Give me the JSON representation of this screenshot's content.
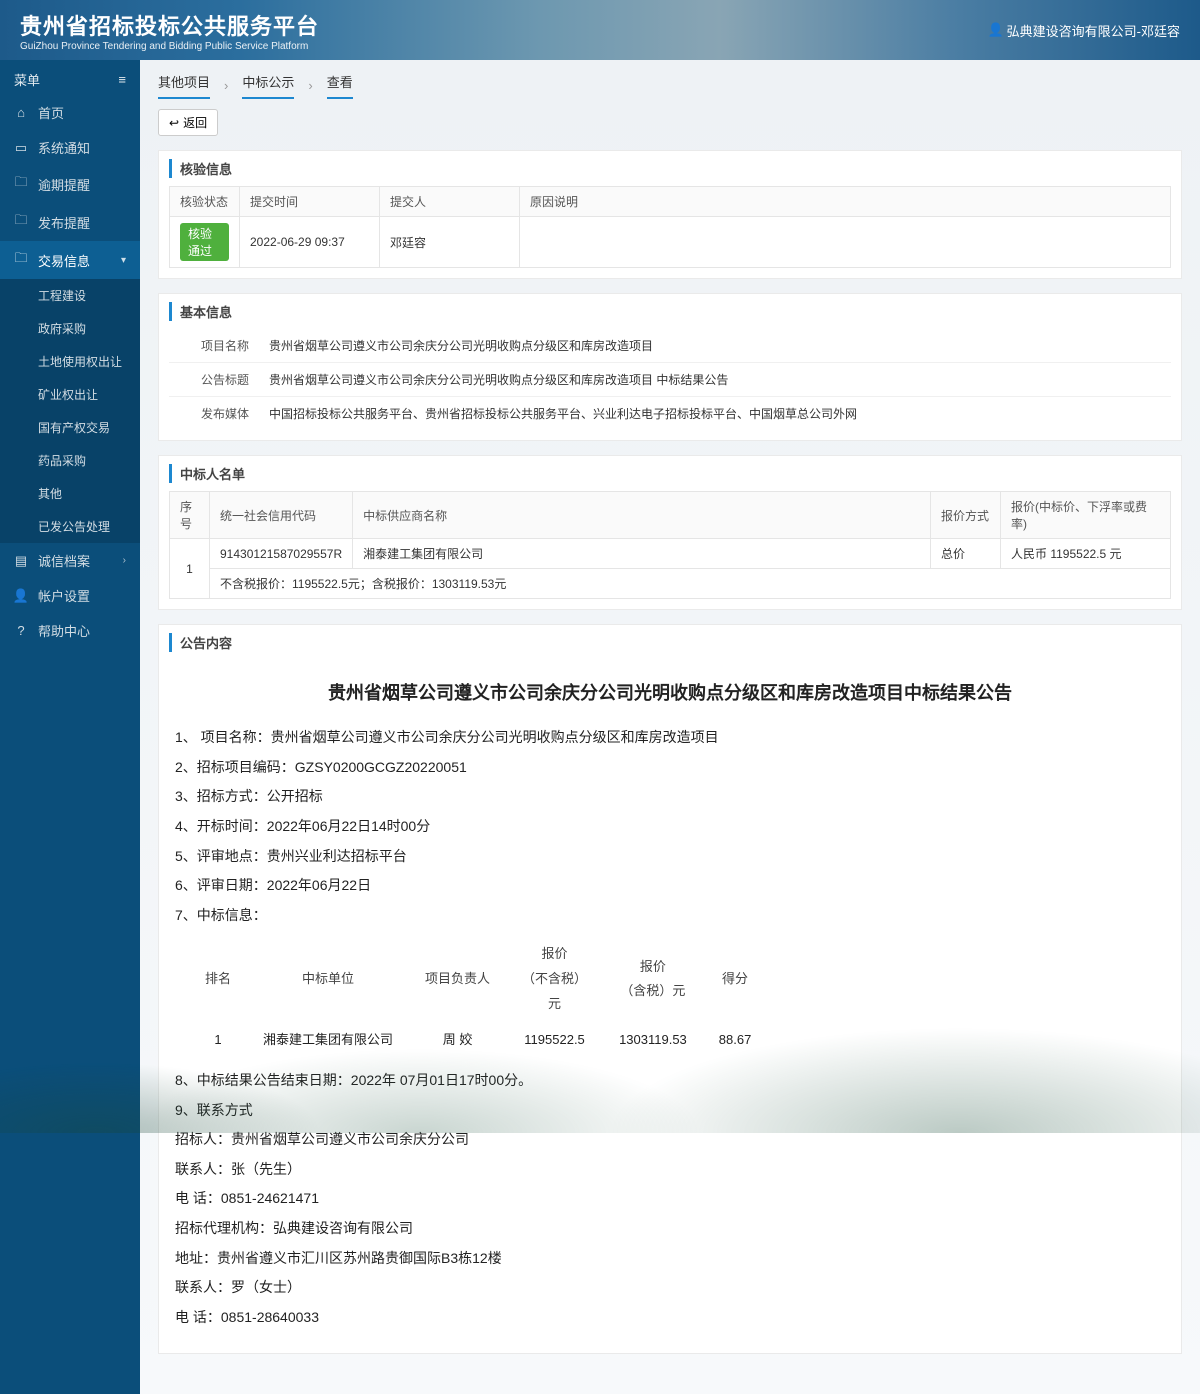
{
  "header": {
    "title": "贵州省招标投标公共服务平台",
    "subtitle": "GuiZhou Province Tendering and Bidding Public Service Platform",
    "user": "弘典建设咨询有限公司-邓廷容"
  },
  "sidebar": {
    "menu_label": "菜单",
    "items": [
      {
        "icon": "home",
        "label": "首页"
      },
      {
        "icon": "bell",
        "label": "系统通知"
      },
      {
        "icon": "clock",
        "label": "逾期提醒"
      },
      {
        "icon": "send",
        "label": "发布提醒"
      },
      {
        "icon": "doc",
        "label": "交易信息",
        "active": true,
        "children": [
          {
            "label": "工程建设"
          },
          {
            "label": "政府采购"
          },
          {
            "label": "土地使用权出让"
          },
          {
            "label": "矿业权出让"
          },
          {
            "label": "国有产权交易"
          },
          {
            "label": "药品采购"
          },
          {
            "label": "其他"
          },
          {
            "label": "已发公告处理"
          }
        ]
      },
      {
        "icon": "card",
        "label": "诚信档案",
        "has_arrow": true
      },
      {
        "icon": "user",
        "label": "帐户设置"
      },
      {
        "icon": "help",
        "label": "帮助中心"
      }
    ]
  },
  "breadcrumb": [
    "其他项目",
    "中标公示",
    "查看"
  ],
  "back_label": "返回",
  "verify": {
    "title": "核验信息",
    "headers": [
      "核验状态",
      "提交时间",
      "提交人",
      "原因说明"
    ],
    "row": {
      "status": "核验通过",
      "time": "2022-06-29 09:37",
      "submitter": "邓廷容",
      "reason": ""
    }
  },
  "basic": {
    "title": "基本信息",
    "project_name_label": "项目名称",
    "project_name": "贵州省烟草公司遵义市公司余庆分公司光明收购点分级区和库房改造项目",
    "notice_title_label": "公告标题",
    "notice_title": "贵州省烟草公司遵义市公司余庆分公司光明收购点分级区和库房改造项目 中标结果公告",
    "media_label": "发布媒体",
    "media": "中国招标投标公共服务平台、贵州省招标投标公共服务平台、兴业利达电子招标投标平台、中国烟草总公司外网"
  },
  "winners": {
    "title": "中标人名单",
    "headers": [
      "序号",
      "统一社会信用代码",
      "中标供应商名称",
      "报价方式",
      "报价(中标价、下浮率或费率)"
    ],
    "row": {
      "idx": "1",
      "usci": "91430121587029557R",
      "name": "湘泰建工集团有限公司",
      "method": "总价",
      "price": "人民币 1195522.5 元",
      "note": "不含税报价：1195522.5元；含税报价：1303119.53元"
    }
  },
  "announce": {
    "title": "公告内容",
    "heading": "贵州省烟草公司遵义市公司余庆分公司光明收购点分级区和库房改造项目中标结果公告",
    "lines": [
      "1、 项目名称：贵州省烟草公司遵义市公司余庆分公司光明收购点分级区和库房改造项目",
      "2、招标项目编码：GZSY0200GCGZ20220051",
      "3、招标方式：公开招标",
      "4、开标时间：2022年06月22日14时00分",
      "5、评审地点：贵州兴业利达招标平台",
      "6、评审日期：2022年06月22日",
      "7、中标信息："
    ],
    "bid_headers": [
      "排名",
      "中标单位",
      "项目负责人",
      "报价\n（不含税）\n元",
      "报价\n（含税）元",
      "得分"
    ],
    "bid_row": [
      "1",
      "湘泰建工集团有限公司",
      "周 姣",
      "1195522.5",
      "1303119.53",
      "88.67"
    ],
    "tail": [
      "8、中标结果公告结束日期：2022年  07月01日17时00分。",
      "9、联系方式",
      "招标人：贵州省烟草公司遵义市公司余庆分公司",
      "联系人：张（先生）",
      "电    话：0851-24621471",
      "招标代理机构：弘典建设咨询有限公司",
      "地址：贵州省遵义市汇川区苏州路贵御国际B3栋12楼",
      "联系人：罗（女士）",
      "电    话：0851-28640033"
    ]
  }
}
